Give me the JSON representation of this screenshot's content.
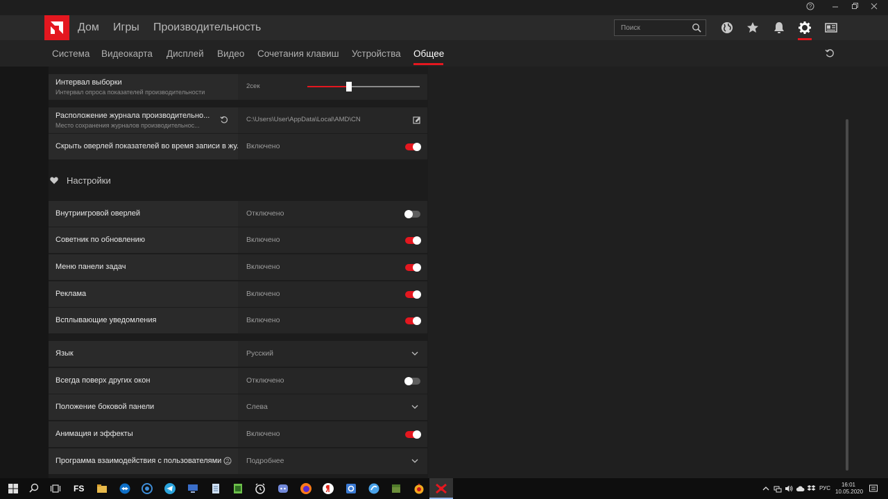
{
  "nav": {
    "items": [
      "Дом",
      "Игры",
      "Производительность"
    ],
    "search_placeholder": "Поиск"
  },
  "subnav": {
    "tabs": [
      "Система",
      "Видеокарта",
      "Дисплей",
      "Видео",
      "Сочетания клавиш",
      "Устройства",
      "Общее"
    ],
    "active": "Общее"
  },
  "perf": {
    "interval": {
      "label": "Интервал выборки",
      "sub": "Интервал опроса показателей производительности",
      "value": "2сек",
      "slider_fraction": 0.37
    },
    "log": {
      "label": "Расположение журнала производительно...",
      "sub": "Место сохранения журналов производительнос...",
      "value": "C:\\Users\\User\\AppData\\Local\\AMD\\CN"
    },
    "hide_overlay": {
      "label": "Скрыть оверлей показателей во время записи в жу...",
      "value": "Включено",
      "on": true
    }
  },
  "settings": {
    "title": "Настройки",
    "group1": [
      {
        "label": "Внутриигровой оверлей",
        "value": "Отключено",
        "on": false
      },
      {
        "label": "Советник по обновлению",
        "value": "Включено",
        "on": true
      },
      {
        "label": "Меню панели задач",
        "value": "Включено",
        "on": true
      },
      {
        "label": "Реклама",
        "value": "Включено",
        "on": true
      },
      {
        "label": "Всплывающие уведомления",
        "value": "Включено",
        "on": true
      }
    ],
    "group2": {
      "language": {
        "label": "Язык",
        "value": "Русский"
      },
      "always_on_top": {
        "label": "Всегда поверх других окон",
        "value": "Отключено",
        "on": false
      },
      "sidebar_pos": {
        "label": "Положение боковой панели",
        "value": "Слева"
      },
      "animation": {
        "label": "Анимация и эффекты",
        "value": "Включено",
        "on": true
      },
      "ux_program": {
        "label": "Программа взаимодействия с пользователями ...",
        "value": "Подробнее"
      }
    }
  },
  "taskbar": {
    "fs_label": "FS",
    "lang": "РУС",
    "time": "16:01",
    "date": "10.05.2020"
  },
  "colors": {
    "accent": "#e4171f",
    "panel": "#2a2a2a",
    "background": "#1b1b1b"
  }
}
